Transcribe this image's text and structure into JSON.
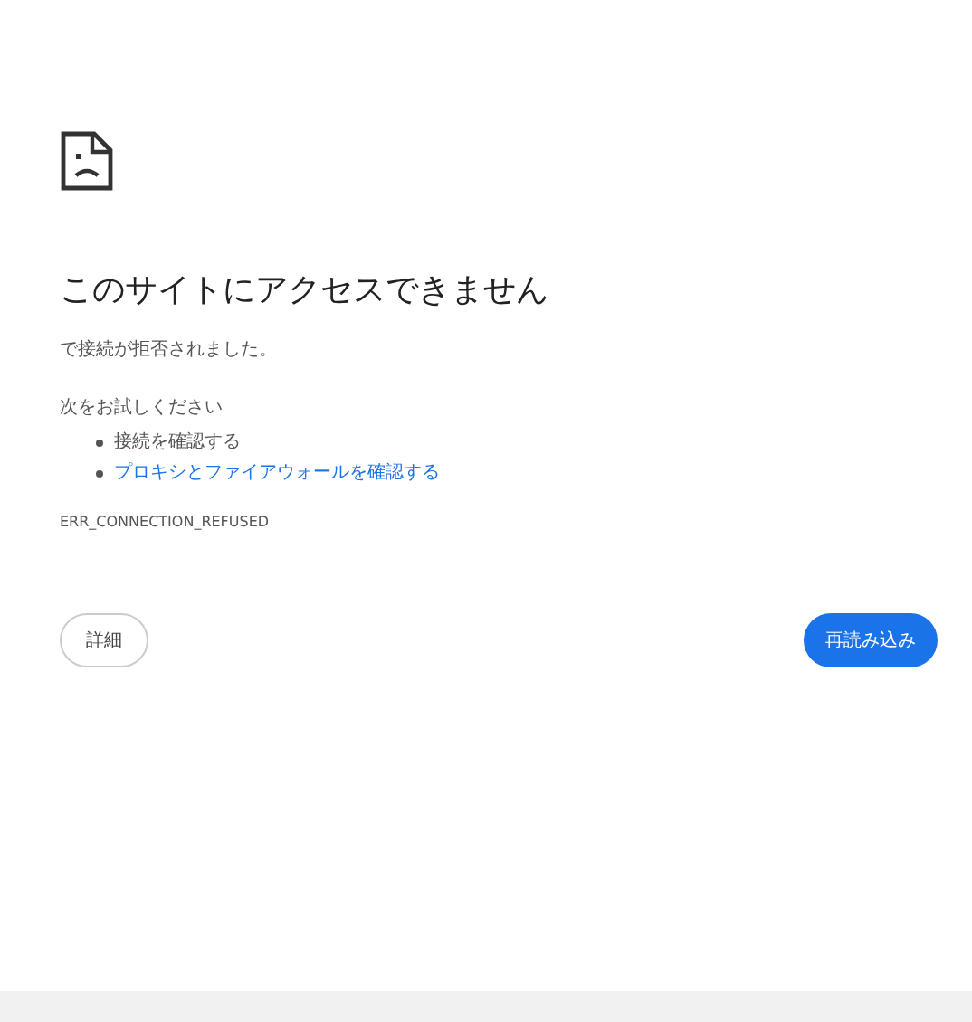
{
  "heading": "このサイトにアクセスできません",
  "message": "で接続が拒否されました。",
  "suggestions_title": "次をお試しください",
  "suggestions": [
    {
      "text": "接続を確認する",
      "kind": "text"
    },
    {
      "text": "プロキシとファイアウォールを確認する",
      "kind": "link"
    }
  ],
  "error_code": "ERR_CONNECTION_REFUSED",
  "buttons": [
    {
      "label": "詳細",
      "kind": "secondary"
    },
    {
      "label": "再読み込み",
      "kind": "primary"
    }
  ]
}
